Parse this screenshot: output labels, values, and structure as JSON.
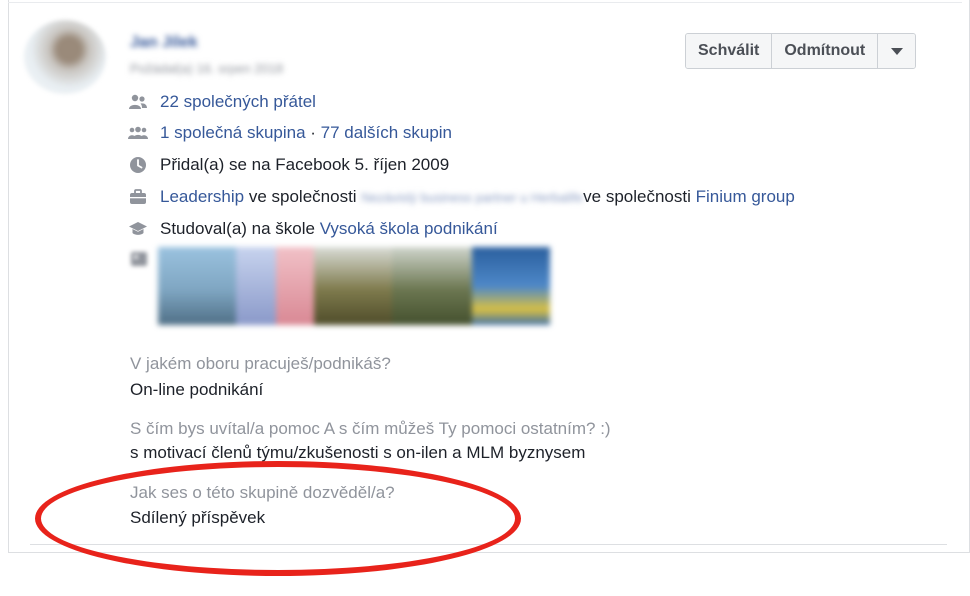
{
  "member": {
    "name": "Jan Jílek",
    "meta": "Požádal(a) 16. srpen 2018"
  },
  "actions": {
    "approve_label": "Schválit",
    "decline_label": "Odmítnout"
  },
  "info": {
    "mutual_friends": "22 společných přátel",
    "groups_common": "1 společná skupina",
    "groups_sep": " · ",
    "groups_more": "77 dalších skupin",
    "joined": "Přidal(a) se na Facebook 5. říjen 2009",
    "work_role": "Leadership",
    "work_sep1": " ve společnosti ",
    "work_blurred": "Nezávislý business partner u Herbalife",
    "work_sep2": "ve společnosti ",
    "work_company": "Finium group",
    "edu_prefix": "Studoval(a) na škole ",
    "edu_school": "Vysoká škola podnikání"
  },
  "photos": [
    {
      "color": "#7fa6c2"
    },
    {
      "color": "#b8c4e0"
    },
    {
      "color": "#e2a0a8"
    },
    {
      "color": "#6e6a3e"
    },
    {
      "color": "#5f6a48"
    },
    {
      "color": "#3e6fa8"
    }
  ],
  "qa": [
    {
      "question": "V jakém oboru pracuješ/podnikáš?",
      "answer": "On-line podnikání"
    },
    {
      "question": "S čím bys uvítal/a pomoc A s čím můžeš Ty pomoci ostatním? :)",
      "answer": "s motivací členů týmu/zkušenosti s on-ilen a MLM byznysem"
    },
    {
      "question": "Jak ses o této skupině dozvěděl/a?",
      "answer": "Sdílený příspěvek"
    }
  ],
  "colors": {
    "link": "#365899",
    "muted": "#90949c",
    "text": "#1d2129",
    "highlight": "#e8231b"
  },
  "icons": [
    "friends-icon",
    "groups-icon",
    "clock-icon",
    "briefcase-icon",
    "graduation-cap-icon",
    "photo-icon",
    "caret-down-icon"
  ]
}
